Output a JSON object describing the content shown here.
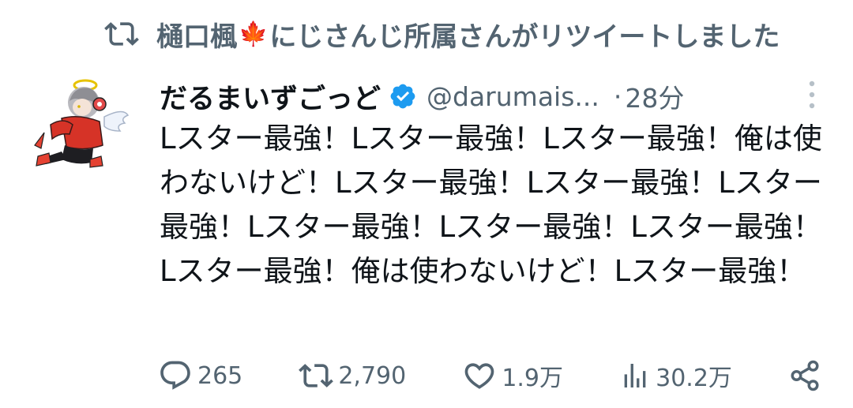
{
  "retweet_banner": {
    "user_name": "樋口楓",
    "leaf_glyph": "🍁",
    "text": "にじさんじ所属さんがリツイートしました"
  },
  "tweet": {
    "display_name": "だるまいずごっど",
    "handle": "@darumais...",
    "separator": "·",
    "time": "28分",
    "text": "Lスター最強！Lスター最強！Lスター最強！俺は使わないけど！Lスター最強！Lスター最強！Lスター最強！Lスター最強！Lスター最強！Lスター最強！Lスター最強！俺は使わないけど！Lスター最強！",
    "verified": true
  },
  "actions": {
    "replies": "265",
    "retweets": "2,790",
    "likes": "1.9万",
    "views": "30.2万"
  },
  "icons": {
    "retweet_banner_icon": "retweet-icon",
    "verified_icon": "verified-badge-icon",
    "more_icon": "more-vertical-icon",
    "reply_icon": "reply-icon",
    "retweet_icon": "retweet-icon",
    "like_icon": "heart-icon",
    "views_icon": "bar-chart-icon",
    "share_icon": "share-icon"
  },
  "colors": {
    "text_primary": "#0f1419",
    "text_secondary": "#536471",
    "verified_blue": "#1d9bf0",
    "leaf_red": "#e0332b"
  }
}
